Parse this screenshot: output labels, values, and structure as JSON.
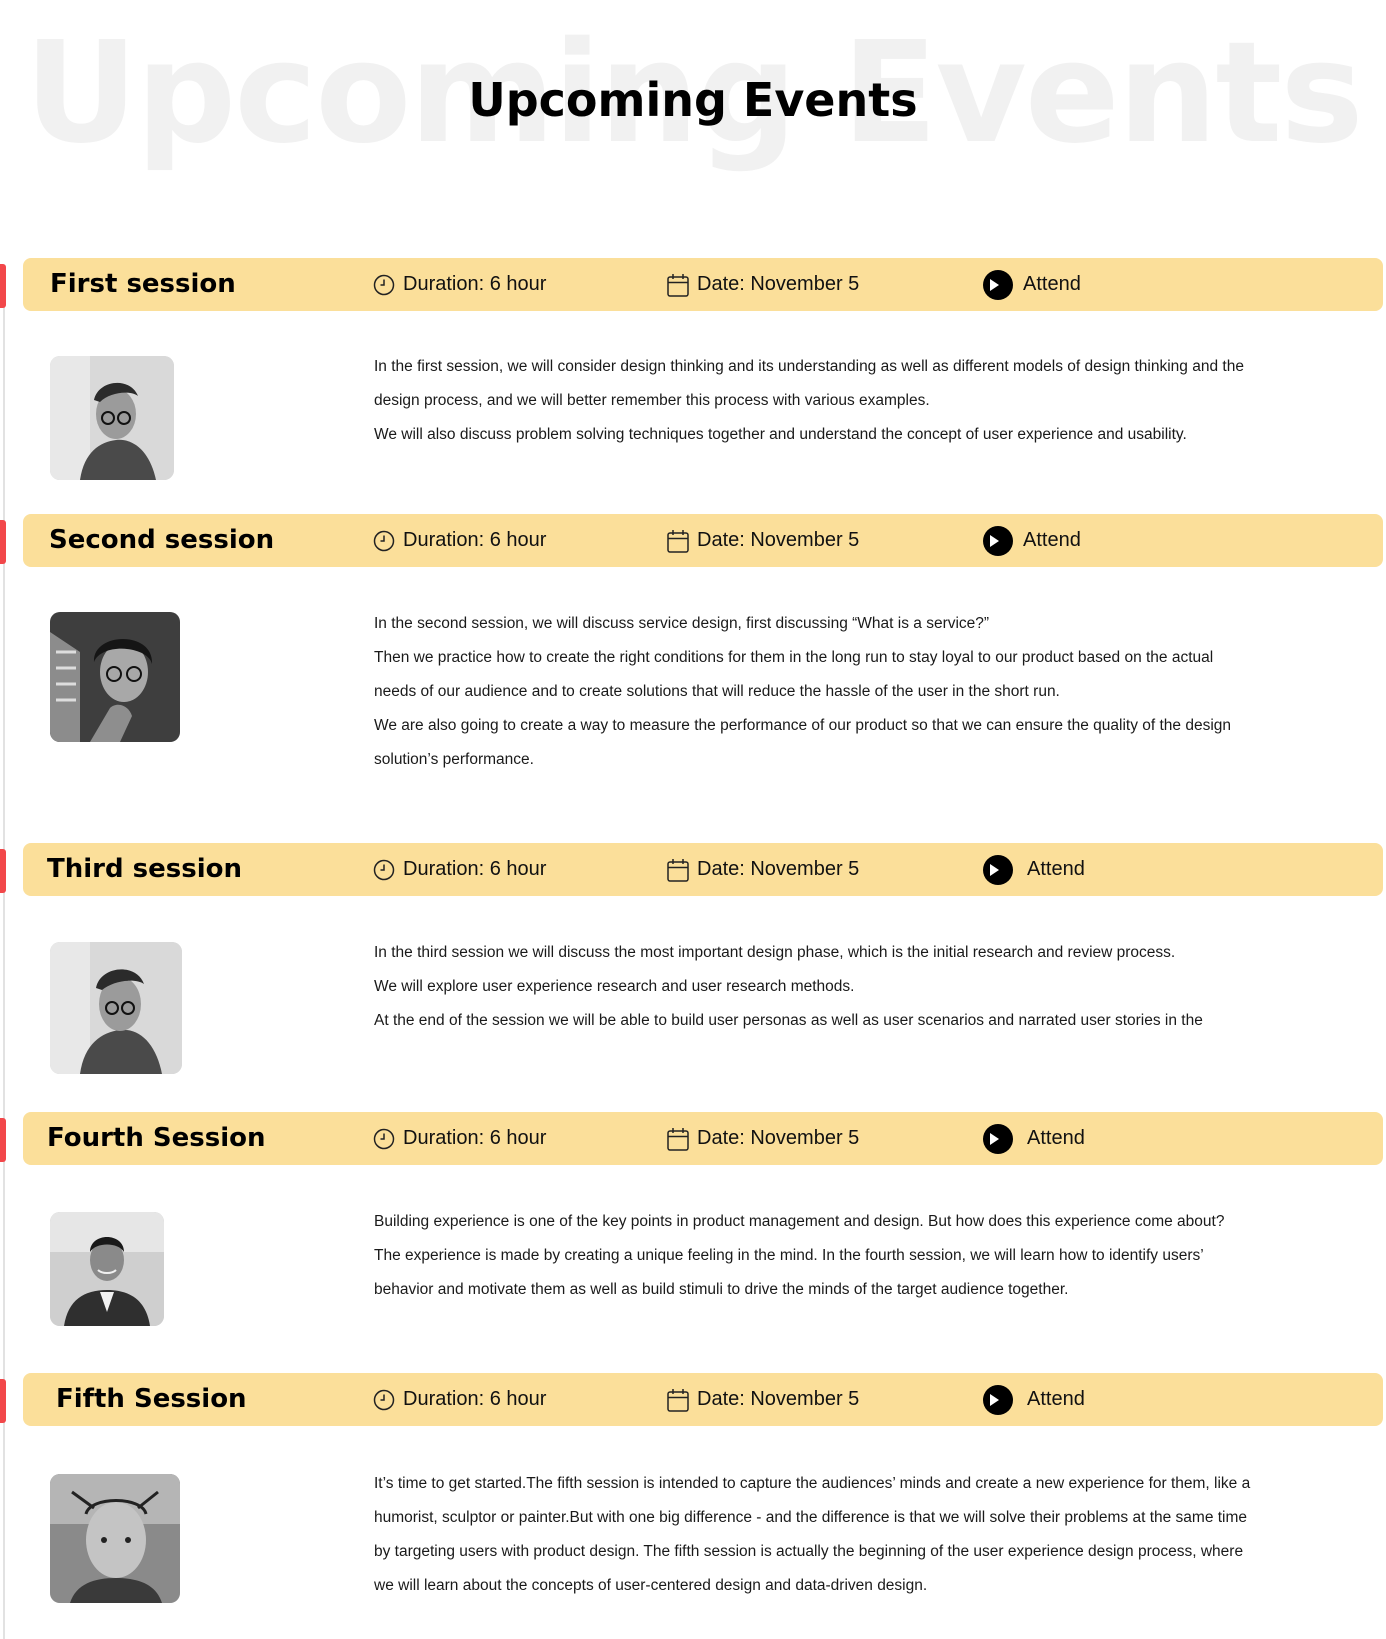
{
  "page": {
    "title_shadow": "Upcoming  Events",
    "title": "Upcoming Events"
  },
  "sessions": [
    {
      "title": "First session",
      "duration": "Duration: 6 hour",
      "date": "Date: November 5",
      "attend": "Attend",
      "avatar": "presenter-photo-glasses",
      "paragraphs": [
        "In the first session, we will consider design thinking and its understanding as well as different models of design thinking and the design process, and we will better remember this process with various examples.",
        "We will also discuss problem solving techniques together and understand the concept of user experience and usability."
      ]
    },
    {
      "title": "Second session",
      "duration": "Duration: 6 hour",
      "date": "Date: November 5",
      "attend": "Attend",
      "avatar": "presenter-photo-curly-hair",
      "paragraphs": [
        "In the second session, we will discuss service design, first discussing “What is a service?”",
        "Then we practice how to create the right conditions for them in the long run to stay loyal to our product based on the actual needs of our audience and to create solutions that will reduce the hassle of the user in the short run.",
        "We are also going to create a way to measure the performance of our product so that we can ensure the quality of the design solution’s performance."
      ]
    },
    {
      "title": "Third session",
      "duration": "Duration: 6 hour",
      "date": "Date: November 5",
      "attend": "Attend",
      "avatar": "presenter-photo-glasses",
      "paragraphs": [
        "In the third session we will discuss the most important design phase, which is the initial research and review process.",
        "We will explore user experience research and user research methods.",
        "At the end of the session we will be able to build user personas as well as user scenarios and narrated user stories in the"
      ]
    },
    {
      "title": "Fourth Session",
      "duration": "Duration: 6 hour",
      "date": "Date: November 5",
      "attend": "Attend",
      "avatar": "presenter-photo-suit",
      "paragraphs": [
        "Building experience is one of the key points in product management and design. But how does this experience come about?",
        "The experience is made by creating a unique feeling in the mind. In the fourth session, we will learn how to identify users’ behavior and motivate them as well as build stimuli to drive the minds of the target audience together."
      ]
    },
    {
      "title": "Fifth Session",
      "duration": "Duration: 6 hour",
      "date": "Date: November 5",
      "attend": "Attend",
      "avatar": "presenter-photo-bald",
      "paragraphs": [
        "It’s time to get started.The fifth session is intended to capture the audiences’ minds and create a new experience for them, like a humorist, sculptor or painter.But with one big difference - and the difference is that we will solve their problems at the same time by targeting users with product design. The fifth session is actually the beginning of the user experience design process, where we will learn about the concepts of user-centered design and data-driven design."
      ]
    }
  ],
  "colors": {
    "bar": "#fbdf9a",
    "marker": "#f2474a",
    "shadow_title": "#f1f1f1"
  }
}
